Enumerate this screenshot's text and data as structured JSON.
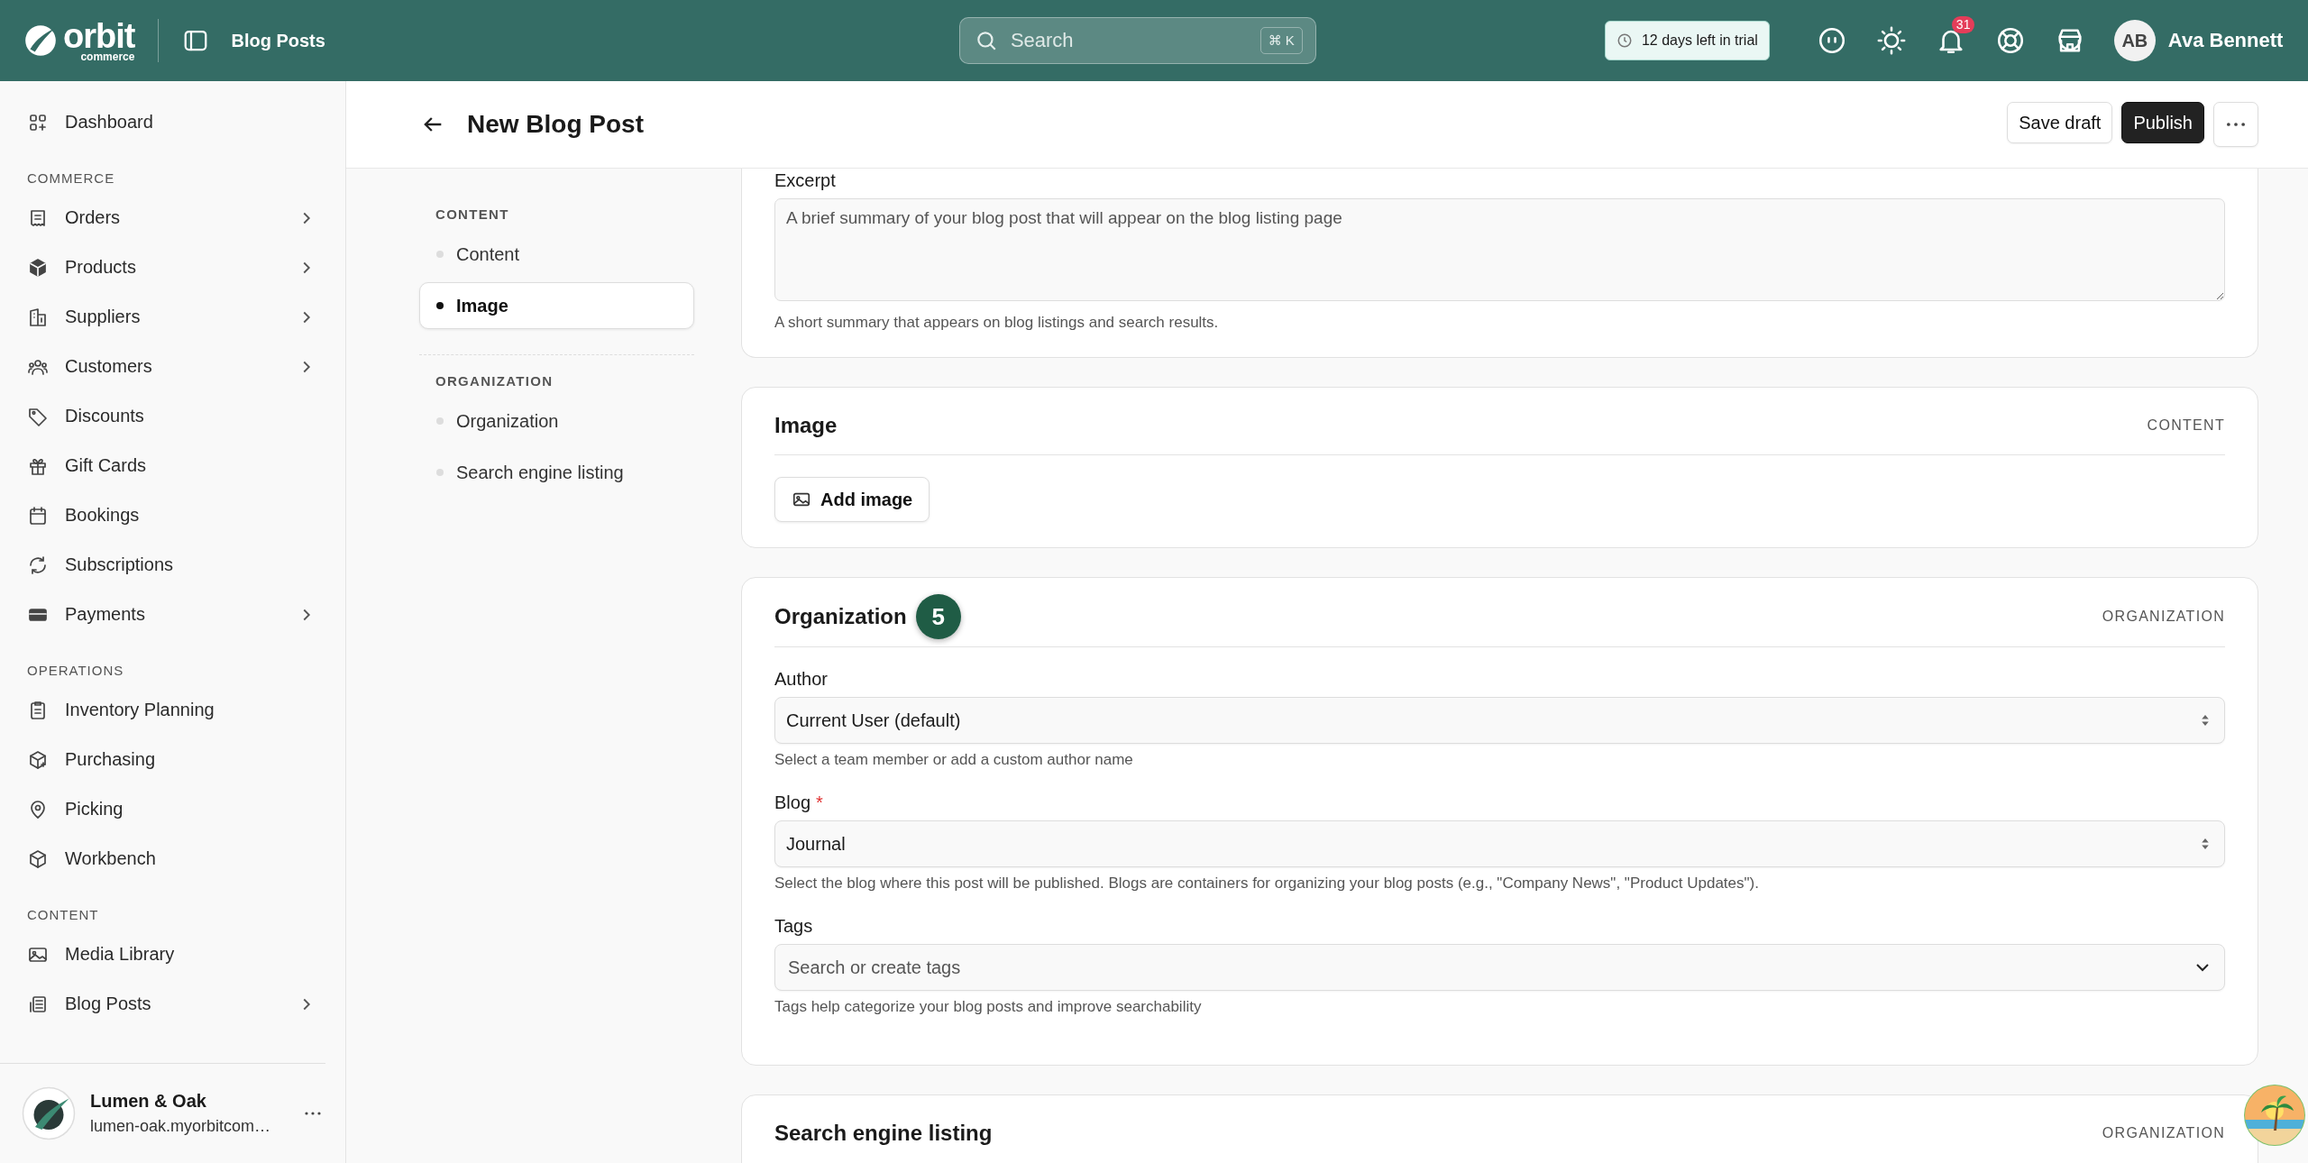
{
  "topbar": {
    "logo": "orbit",
    "logo_sub": "commerce",
    "breadcrumb": "Blog Posts",
    "search": {
      "placeholder": "Search",
      "shortcut": "⌘ K"
    },
    "trial": "12 days left in trial",
    "notifications": "31",
    "user": {
      "initials": "AB",
      "name": "Ava Bennett"
    }
  },
  "sidebar": {
    "groups": [
      {
        "items": [
          {
            "label": "Dashboard",
            "expandable": false
          }
        ]
      },
      {
        "title": "COMMERCE",
        "items": [
          {
            "label": "Orders",
            "expandable": true
          },
          {
            "label": "Products",
            "expandable": true
          },
          {
            "label": "Suppliers",
            "expandable": true
          },
          {
            "label": "Customers",
            "expandable": true
          },
          {
            "label": "Discounts",
            "expandable": false
          },
          {
            "label": "Gift Cards",
            "expandable": false
          },
          {
            "label": "Bookings",
            "expandable": false
          },
          {
            "label": "Subscriptions",
            "expandable": false
          },
          {
            "label": "Payments",
            "expandable": true
          }
        ]
      },
      {
        "title": "OPERATIONS",
        "items": [
          {
            "label": "Inventory Planning",
            "expandable": false
          },
          {
            "label": "Purchasing",
            "expandable": false
          },
          {
            "label": "Picking",
            "expandable": false
          },
          {
            "label": "Workbench",
            "expandable": false
          }
        ]
      },
      {
        "title": "CONTENT",
        "items": [
          {
            "label": "Media Library",
            "expandable": false
          },
          {
            "label": "Blog Posts",
            "expandable": true
          }
        ]
      }
    ],
    "store": {
      "name": "Lumen & Oak",
      "domain": "lumen-oak.myorbitcom…"
    }
  },
  "page": {
    "title": "New Blog Post",
    "buttons": [
      "Save draft",
      "Publish"
    ]
  },
  "section_nav": [
    {
      "title": "CONTENT",
      "items": [
        {
          "label": "Content",
          "selected": false
        },
        {
          "label": "Image",
          "selected": true
        }
      ]
    },
    {
      "title": "ORGANIZATION",
      "items": [
        {
          "label": "Organization",
          "selected": false
        },
        {
          "label": "Search engine listing",
          "selected": false
        }
      ]
    }
  ],
  "excerpt": {
    "label": "Excerpt",
    "placeholder": "A brief summary of your blog post that will appear on the blog listing page",
    "help": "A short summary that appears on blog listings and search results."
  },
  "image_card": {
    "title": "Image",
    "section": "CONTENT",
    "button": "Add image"
  },
  "organization_card": {
    "title": "Organization",
    "step": "5",
    "section": "ORGANIZATION",
    "fields": [
      {
        "kind": "select",
        "label": "Author",
        "value": "Current User (default)",
        "help": "Select a team member or add a custom author name"
      },
      {
        "kind": "select",
        "label": "Blog",
        "required_mark": "*",
        "value": "Journal",
        "help": "Select the blog where this post will be published. Blogs are containers for organizing your blog posts (e.g., \"Company News\", \"Product Updates\")."
      },
      {
        "kind": "combobox",
        "label": "Tags",
        "placeholder": "Search or create tags",
        "help": "Tags help categorize your blog posts and improve searchability"
      }
    ]
  },
  "seo_card": {
    "title": "Search engine listing",
    "section": "ORGANIZATION"
  }
}
